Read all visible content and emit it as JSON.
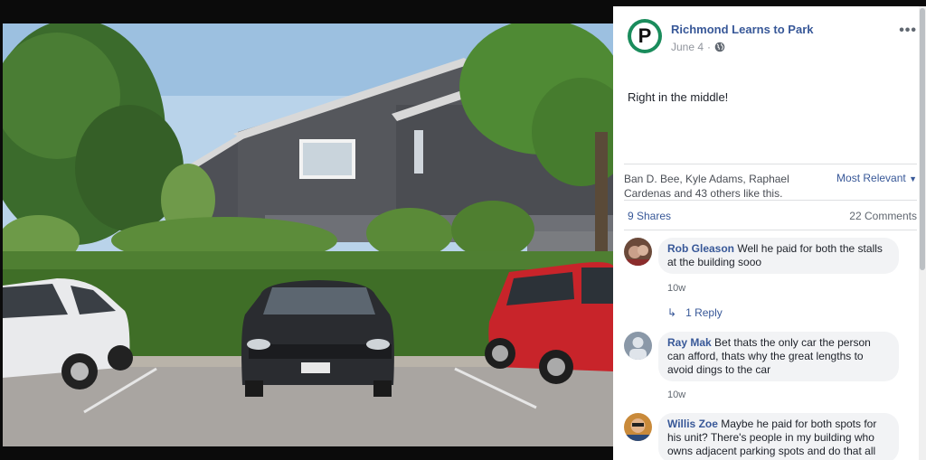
{
  "post": {
    "page_name": "Richmond Learns to Park",
    "date": "June 4",
    "separator": "·",
    "more_icon": "more-horizontal-icon",
    "text": "Right in the middle!"
  },
  "likes": {
    "summary": "Ban D. Bee, Kyle Adams, Raphael Cardenas and 43 others like this.",
    "sort_label": "Most Relevant"
  },
  "stats": {
    "shares": "9 Shares",
    "comments": "22 Comments"
  },
  "comments": [
    {
      "author": "Rob Gleason",
      "text": "Well he paid for both the stalls at the building sooo",
      "time": "10w",
      "reply_label": "1 Reply"
    },
    {
      "author": "Ray Mak",
      "text": "Bet thats the only car the person can afford, thats why the great lengths to avoid dings to the car",
      "time": "10w"
    },
    {
      "author": "Willis Zoe",
      "text": "Maybe he paid for both spots for his unit? There's people in my building who owns adjacent parking spots and do that all"
    }
  ],
  "colors": {
    "link": "#385898",
    "logo_green": "#1a8c5c",
    "bubble": "#f2f3f5"
  }
}
